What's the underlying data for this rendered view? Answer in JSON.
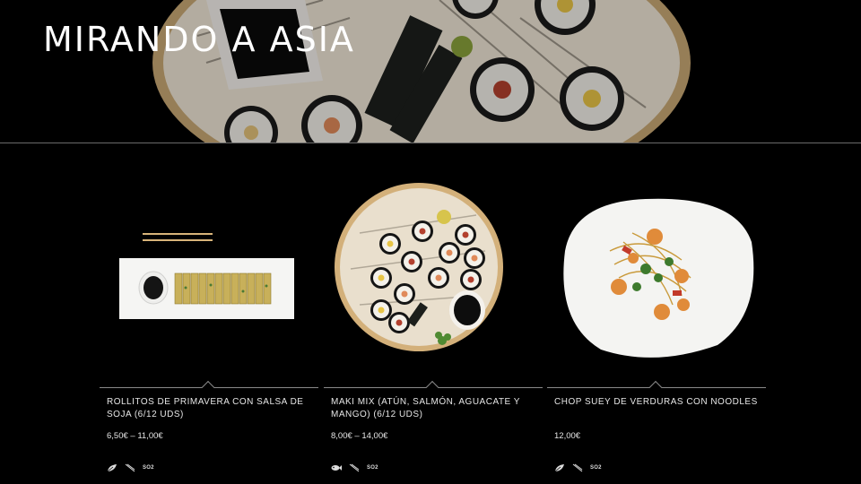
{
  "header": {
    "title": "MIRANDO A ASIA"
  },
  "products": [
    {
      "name": "ROLLITOS DE PRIMAVERA CON SALSA DE SOJA (6/12 UDS)",
      "price": "6,50€ – 11,00€",
      "icons": [
        "leaf-icon",
        "chopsticks-icon"
      ],
      "tag": "SO2"
    },
    {
      "name": "MAKI MIX (ATÚN, SALMÓN, AGUACATE Y MANGO) (6/12 UDS)",
      "price": "8,00€ – 14,00€",
      "icons": [
        "fish-icon",
        "chopsticks-icon"
      ],
      "tag": "SO2"
    },
    {
      "name": "CHOP SUEY DE VERDURAS CON NOODLES",
      "price": "12,00€",
      "icons": [
        "leaf-icon",
        "chopsticks-icon"
      ],
      "tag": "SO2"
    }
  ],
  "colors": {
    "background": "#000000",
    "text": "#ffffff",
    "divider": "#8a8a8a"
  }
}
